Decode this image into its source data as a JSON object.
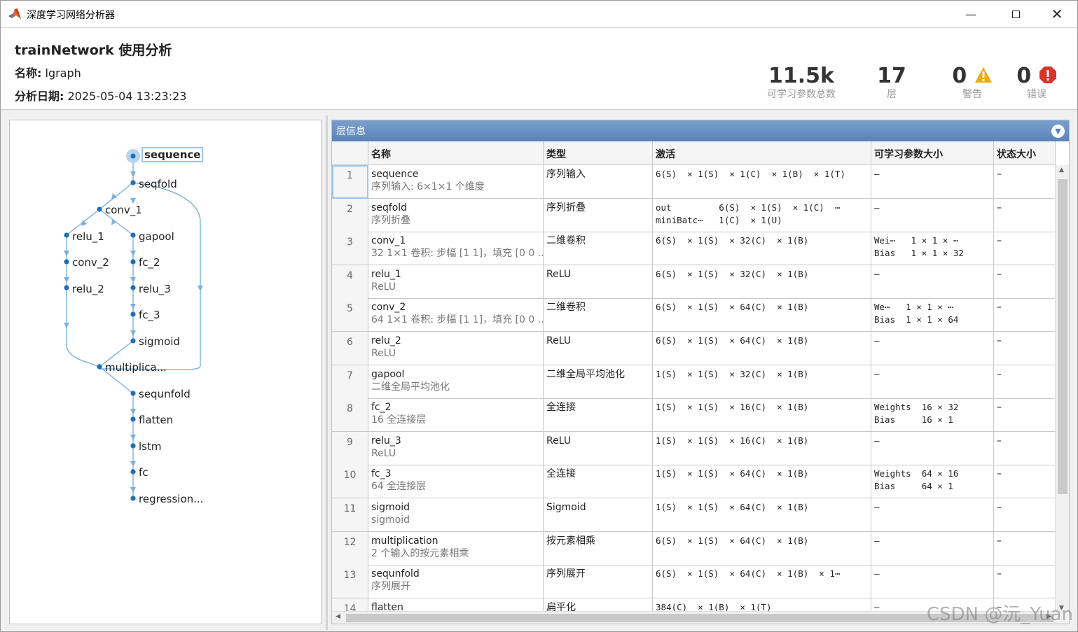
{
  "window": {
    "title": "深度学习网络分析器"
  },
  "header": {
    "title": "trainNetwork 使用分析",
    "name_label": "名称:",
    "name_value": "lgraph",
    "date_label": "分析日期:",
    "date_value": "2025-05-04 13:23:23"
  },
  "stats": [
    {
      "value": "11.5k",
      "label": "可学习参数总数"
    },
    {
      "value": "17",
      "label": "层"
    },
    {
      "value": "0",
      "label": "警告"
    },
    {
      "value": "0",
      "label": "错误"
    }
  ],
  "graph": {
    "nodes": [
      "sequence",
      "seqfold",
      "conv_1",
      "relu_1",
      "gapool",
      "conv_2",
      "fc_2",
      "relu_2",
      "relu_3",
      "fc_3",
      "sigmoid",
      "multiplica...",
      "sequnfold",
      "flatten",
      "lstm",
      "fc",
      "regression..."
    ]
  },
  "panel": {
    "title": "层信息"
  },
  "columns": [
    "名称",
    "类型",
    "激活",
    "可学习参数大小",
    "状态大小"
  ],
  "rows": [
    {
      "idx": "1",
      "name": "sequence",
      "desc": "序列输入: 6×1×1 个维度",
      "type": "序列输入",
      "act": [
        "6(S)  × 1(S)  × 1(C)  × 1(B)  × 1(T)"
      ],
      "learn": [
        "–"
      ],
      "state": "–"
    },
    {
      "idx": "2",
      "name": "seqfold",
      "desc": "序列折叠",
      "type": "序列折叠",
      "act": [
        "out         6(S)  × 1(S)  × 1(C)  ⋯",
        "miniBatc⋯   1(C)  × 1(U)"
      ],
      "learn": [
        "–"
      ],
      "state": "–"
    },
    {
      "idx": "3",
      "name": "conv_1",
      "desc": "32 1×1 卷积: 步幅 [1 1]，填充 [0 0 ...",
      "type": "二维卷积",
      "act": [
        "6(S)  × 1(S)  × 32(C)  × 1(B)"
      ],
      "learn": [
        "Wei⋯   1 × 1 × ⋯",
        "Bias   1 × 1 × 32"
      ],
      "state": "–"
    },
    {
      "idx": "4",
      "name": "relu_1",
      "desc": "ReLU",
      "type": "ReLU",
      "act": [
        "6(S)  × 1(S)  × 32(C)  × 1(B)"
      ],
      "learn": [
        "–"
      ],
      "state": "–"
    },
    {
      "idx": "5",
      "name": "conv_2",
      "desc": "64 1×1 卷积: 步幅 [1 1]，填充 [0 0 ...",
      "type": "二维卷积",
      "act": [
        "6(S)  × 1(S)  × 64(C)  × 1(B)"
      ],
      "learn": [
        "We⋯   1 × 1 × ⋯",
        "Bias  1 × 1 × 64"
      ],
      "state": "–"
    },
    {
      "idx": "6",
      "name": "relu_2",
      "desc": "ReLU",
      "type": "ReLU",
      "act": [
        "6(S)  × 1(S)  × 64(C)  × 1(B)"
      ],
      "learn": [
        "–"
      ],
      "state": "–"
    },
    {
      "idx": "7",
      "name": "gapool",
      "desc": "二维全局平均池化",
      "type": "二维全局平均池化",
      "act": [
        "1(S)  × 1(S)  × 32(C)  × 1(B)"
      ],
      "learn": [
        "–"
      ],
      "state": "–"
    },
    {
      "idx": "8",
      "name": "fc_2",
      "desc": "16 全连接层",
      "type": "全连接",
      "act": [
        "1(S)  × 1(S)  × 16(C)  × 1(B)"
      ],
      "learn": [
        "Weights  16 × 32",
        "Bias     16 × 1"
      ],
      "state": "–"
    },
    {
      "idx": "9",
      "name": "relu_3",
      "desc": "ReLU",
      "type": "ReLU",
      "act": [
        "1(S)  × 1(S)  × 16(C)  × 1(B)"
      ],
      "learn": [
        "–"
      ],
      "state": "–"
    },
    {
      "idx": "10",
      "name": "fc_3",
      "desc": "64 全连接层",
      "type": "全连接",
      "act": [
        "1(S)  × 1(S)  × 64(C)  × 1(B)"
      ],
      "learn": [
        "Weights  64 × 16",
        "Bias     64 × 1"
      ],
      "state": "–"
    },
    {
      "idx": "11",
      "name": "sigmoid",
      "desc": "sigmoid",
      "type": "Sigmoid",
      "act": [
        "1(S)  × 1(S)  × 64(C)  × 1(B)"
      ],
      "learn": [
        "–"
      ],
      "state": "–"
    },
    {
      "idx": "12",
      "name": "multiplication",
      "desc": "2 个输入的按元素相乘",
      "type": "按元素相乘",
      "act": [
        "6(S)  × 1(S)  × 64(C)  × 1(B)"
      ],
      "learn": [
        "–"
      ],
      "state": "–"
    },
    {
      "idx": "13",
      "name": "sequnfold",
      "desc": "序列展开",
      "type": "序列展开",
      "act": [
        "6(S)  × 1(S)  × 64(C)  × 1(B)  × 1⋯"
      ],
      "learn": [
        "–"
      ],
      "state": "–"
    },
    {
      "idx": "14",
      "name": "flatten",
      "desc": "",
      "type": "扁平化",
      "act": [
        "384(C)  × 1(B)  × 1(T)"
      ],
      "learn": [
        "–"
      ],
      "state": "–"
    }
  ],
  "watermark": "CSDN @沅_Yuan"
}
